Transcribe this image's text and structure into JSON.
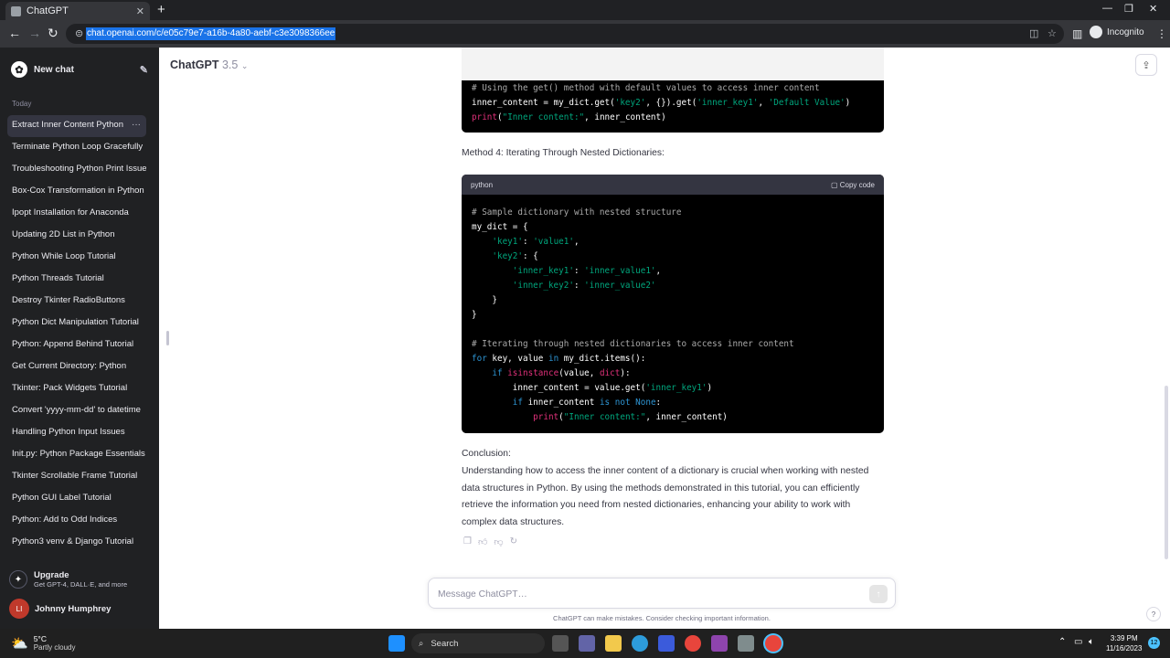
{
  "browser": {
    "tab_title": "ChatGPT",
    "url": "chat.openai.com/c/e05c79e7-a16b-4a80-aebf-c3e3098366ee",
    "profile_label": "Incognito"
  },
  "sidebar": {
    "new_chat_label": "New chat",
    "section_today": "Today",
    "chats": [
      "Extract Inner Content Python",
      "Terminate Python Loop Gracefully",
      "Troubleshooting Python Print Issues",
      "Box-Cox Transformation in Python",
      "Ipopt Installation for Anaconda",
      "Updating 2D List in Python",
      "Python While Loop Tutorial",
      "Python Threads Tutorial",
      "Destroy Tkinter RadioButtons",
      "Python Dict Manipulation Tutorial",
      "Python: Append Behind Tutorial",
      "Get Current Directory: Python",
      "Tkinter: Pack Widgets Tutorial",
      "Convert 'yyyy-mm-dd' to datetime",
      "Handling Python Input Issues",
      "Init.py: Python Package Essentials",
      "Tkinter Scrollable Frame Tutorial",
      "Python GUI Label Tutorial",
      "Python: Add to Odd Indices",
      "Python3 venv & Django Tutorial"
    ],
    "more_icon": "···",
    "upgrade_title": "Upgrade",
    "upgrade_sub": "Get GPT-4, DALL·E, and more",
    "user_initials": "LI",
    "user_name": "Johnny Humphrey"
  },
  "header": {
    "model_name": "ChatGPT",
    "model_version": "3.5"
  },
  "content": {
    "method4_heading": "Method 4: Iterating Through Nested Dictionaries:",
    "code_lang": "python",
    "copy_code_label": "Copy code",
    "conclusion_label": "Conclusion:",
    "conclusion_text": "Understanding how to access the inner content of a dictionary is crucial when working with nested data structures in Python. By using the methods demonstrated in this tutorial, you can efficiently retrieve the information you need from nested dictionaries, enhancing your ability to work with complex data structures."
  },
  "composer": {
    "placeholder": "Message ChatGPT…",
    "disclaimer": "ChatGPT can make mistakes. Consider checking important information."
  },
  "taskbar": {
    "temp": "5°C",
    "condition": "Partly cloudy",
    "search_label": "Search",
    "time": "3:39 PM",
    "date": "11/16/2023",
    "notifications": "12"
  }
}
